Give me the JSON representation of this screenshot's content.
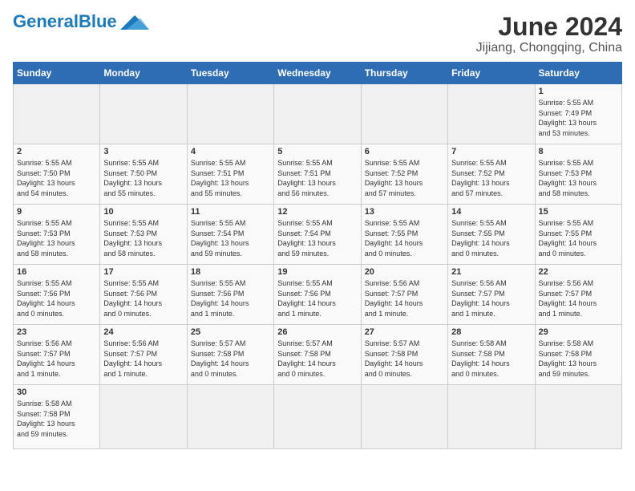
{
  "logo": {
    "general": "General",
    "blue": "Blue"
  },
  "header": {
    "month": "June 2024",
    "location": "Jijiang, Chongqing, China"
  },
  "weekdays": [
    "Sunday",
    "Monday",
    "Tuesday",
    "Wednesday",
    "Thursday",
    "Friday",
    "Saturday"
  ],
  "weeks": [
    [
      {
        "day": "",
        "info": ""
      },
      {
        "day": "",
        "info": ""
      },
      {
        "day": "",
        "info": ""
      },
      {
        "day": "",
        "info": ""
      },
      {
        "day": "",
        "info": ""
      },
      {
        "day": "",
        "info": ""
      },
      {
        "day": "1",
        "info": "Sunrise: 5:55 AM\nSunset: 7:49 PM\nDaylight: 13 hours\nand 53 minutes."
      }
    ],
    [
      {
        "day": "2",
        "info": "Sunrise: 5:55 AM\nSunset: 7:50 PM\nDaylight: 13 hours\nand 54 minutes."
      },
      {
        "day": "3",
        "info": "Sunrise: 5:55 AM\nSunset: 7:50 PM\nDaylight: 13 hours\nand 55 minutes."
      },
      {
        "day": "4",
        "info": "Sunrise: 5:55 AM\nSunset: 7:51 PM\nDaylight: 13 hours\nand 55 minutes."
      },
      {
        "day": "5",
        "info": "Sunrise: 5:55 AM\nSunset: 7:51 PM\nDaylight: 13 hours\nand 56 minutes."
      },
      {
        "day": "6",
        "info": "Sunrise: 5:55 AM\nSunset: 7:52 PM\nDaylight: 13 hours\nand 57 minutes."
      },
      {
        "day": "7",
        "info": "Sunrise: 5:55 AM\nSunset: 7:52 PM\nDaylight: 13 hours\nand 57 minutes."
      },
      {
        "day": "8",
        "info": "Sunrise: 5:55 AM\nSunset: 7:53 PM\nDaylight: 13 hours\nand 58 minutes."
      }
    ],
    [
      {
        "day": "9",
        "info": "Sunrise: 5:55 AM\nSunset: 7:53 PM\nDaylight: 13 hours\nand 58 minutes."
      },
      {
        "day": "10",
        "info": "Sunrise: 5:55 AM\nSunset: 7:53 PM\nDaylight: 13 hours\nand 58 minutes."
      },
      {
        "day": "11",
        "info": "Sunrise: 5:55 AM\nSunset: 7:54 PM\nDaylight: 13 hours\nand 59 minutes."
      },
      {
        "day": "12",
        "info": "Sunrise: 5:55 AM\nSunset: 7:54 PM\nDaylight: 13 hours\nand 59 minutes."
      },
      {
        "day": "13",
        "info": "Sunrise: 5:55 AM\nSunset: 7:55 PM\nDaylight: 14 hours\nand 0 minutes."
      },
      {
        "day": "14",
        "info": "Sunrise: 5:55 AM\nSunset: 7:55 PM\nDaylight: 14 hours\nand 0 minutes."
      },
      {
        "day": "15",
        "info": "Sunrise: 5:55 AM\nSunset: 7:55 PM\nDaylight: 14 hours\nand 0 minutes."
      }
    ],
    [
      {
        "day": "16",
        "info": "Sunrise: 5:55 AM\nSunset: 7:56 PM\nDaylight: 14 hours\nand 0 minutes."
      },
      {
        "day": "17",
        "info": "Sunrise: 5:55 AM\nSunset: 7:56 PM\nDaylight: 14 hours\nand 0 minutes."
      },
      {
        "day": "18",
        "info": "Sunrise: 5:55 AM\nSunset: 7:56 PM\nDaylight: 14 hours\nand 1 minute."
      },
      {
        "day": "19",
        "info": "Sunrise: 5:55 AM\nSunset: 7:56 PM\nDaylight: 14 hours\nand 1 minute."
      },
      {
        "day": "20",
        "info": "Sunrise: 5:56 AM\nSunset: 7:57 PM\nDaylight: 14 hours\nand 1 minute."
      },
      {
        "day": "21",
        "info": "Sunrise: 5:56 AM\nSunset: 7:57 PM\nDaylight: 14 hours\nand 1 minute."
      },
      {
        "day": "22",
        "info": "Sunrise: 5:56 AM\nSunset: 7:57 PM\nDaylight: 14 hours\nand 1 minute."
      }
    ],
    [
      {
        "day": "23",
        "info": "Sunrise: 5:56 AM\nSunset: 7:57 PM\nDaylight: 14 hours\nand 1 minute."
      },
      {
        "day": "24",
        "info": "Sunrise: 5:56 AM\nSunset: 7:57 PM\nDaylight: 14 hours\nand 1 minute."
      },
      {
        "day": "25",
        "info": "Sunrise: 5:57 AM\nSunset: 7:58 PM\nDaylight: 14 hours\nand 0 minutes."
      },
      {
        "day": "26",
        "info": "Sunrise: 5:57 AM\nSunset: 7:58 PM\nDaylight: 14 hours\nand 0 minutes."
      },
      {
        "day": "27",
        "info": "Sunrise: 5:57 AM\nSunset: 7:58 PM\nDaylight: 14 hours\nand 0 minutes."
      },
      {
        "day": "28",
        "info": "Sunrise: 5:58 AM\nSunset: 7:58 PM\nDaylight: 14 hours\nand 0 minutes."
      },
      {
        "day": "29",
        "info": "Sunrise: 5:58 AM\nSunset: 7:58 PM\nDaylight: 13 hours\nand 59 minutes."
      }
    ],
    [
      {
        "day": "30",
        "info": "Sunrise: 5:58 AM\nSunset: 7:58 PM\nDaylight: 13 hours\nand 59 minutes."
      },
      {
        "day": "",
        "info": ""
      },
      {
        "day": "",
        "info": ""
      },
      {
        "day": "",
        "info": ""
      },
      {
        "day": "",
        "info": ""
      },
      {
        "day": "",
        "info": ""
      },
      {
        "day": "",
        "info": ""
      }
    ]
  ]
}
